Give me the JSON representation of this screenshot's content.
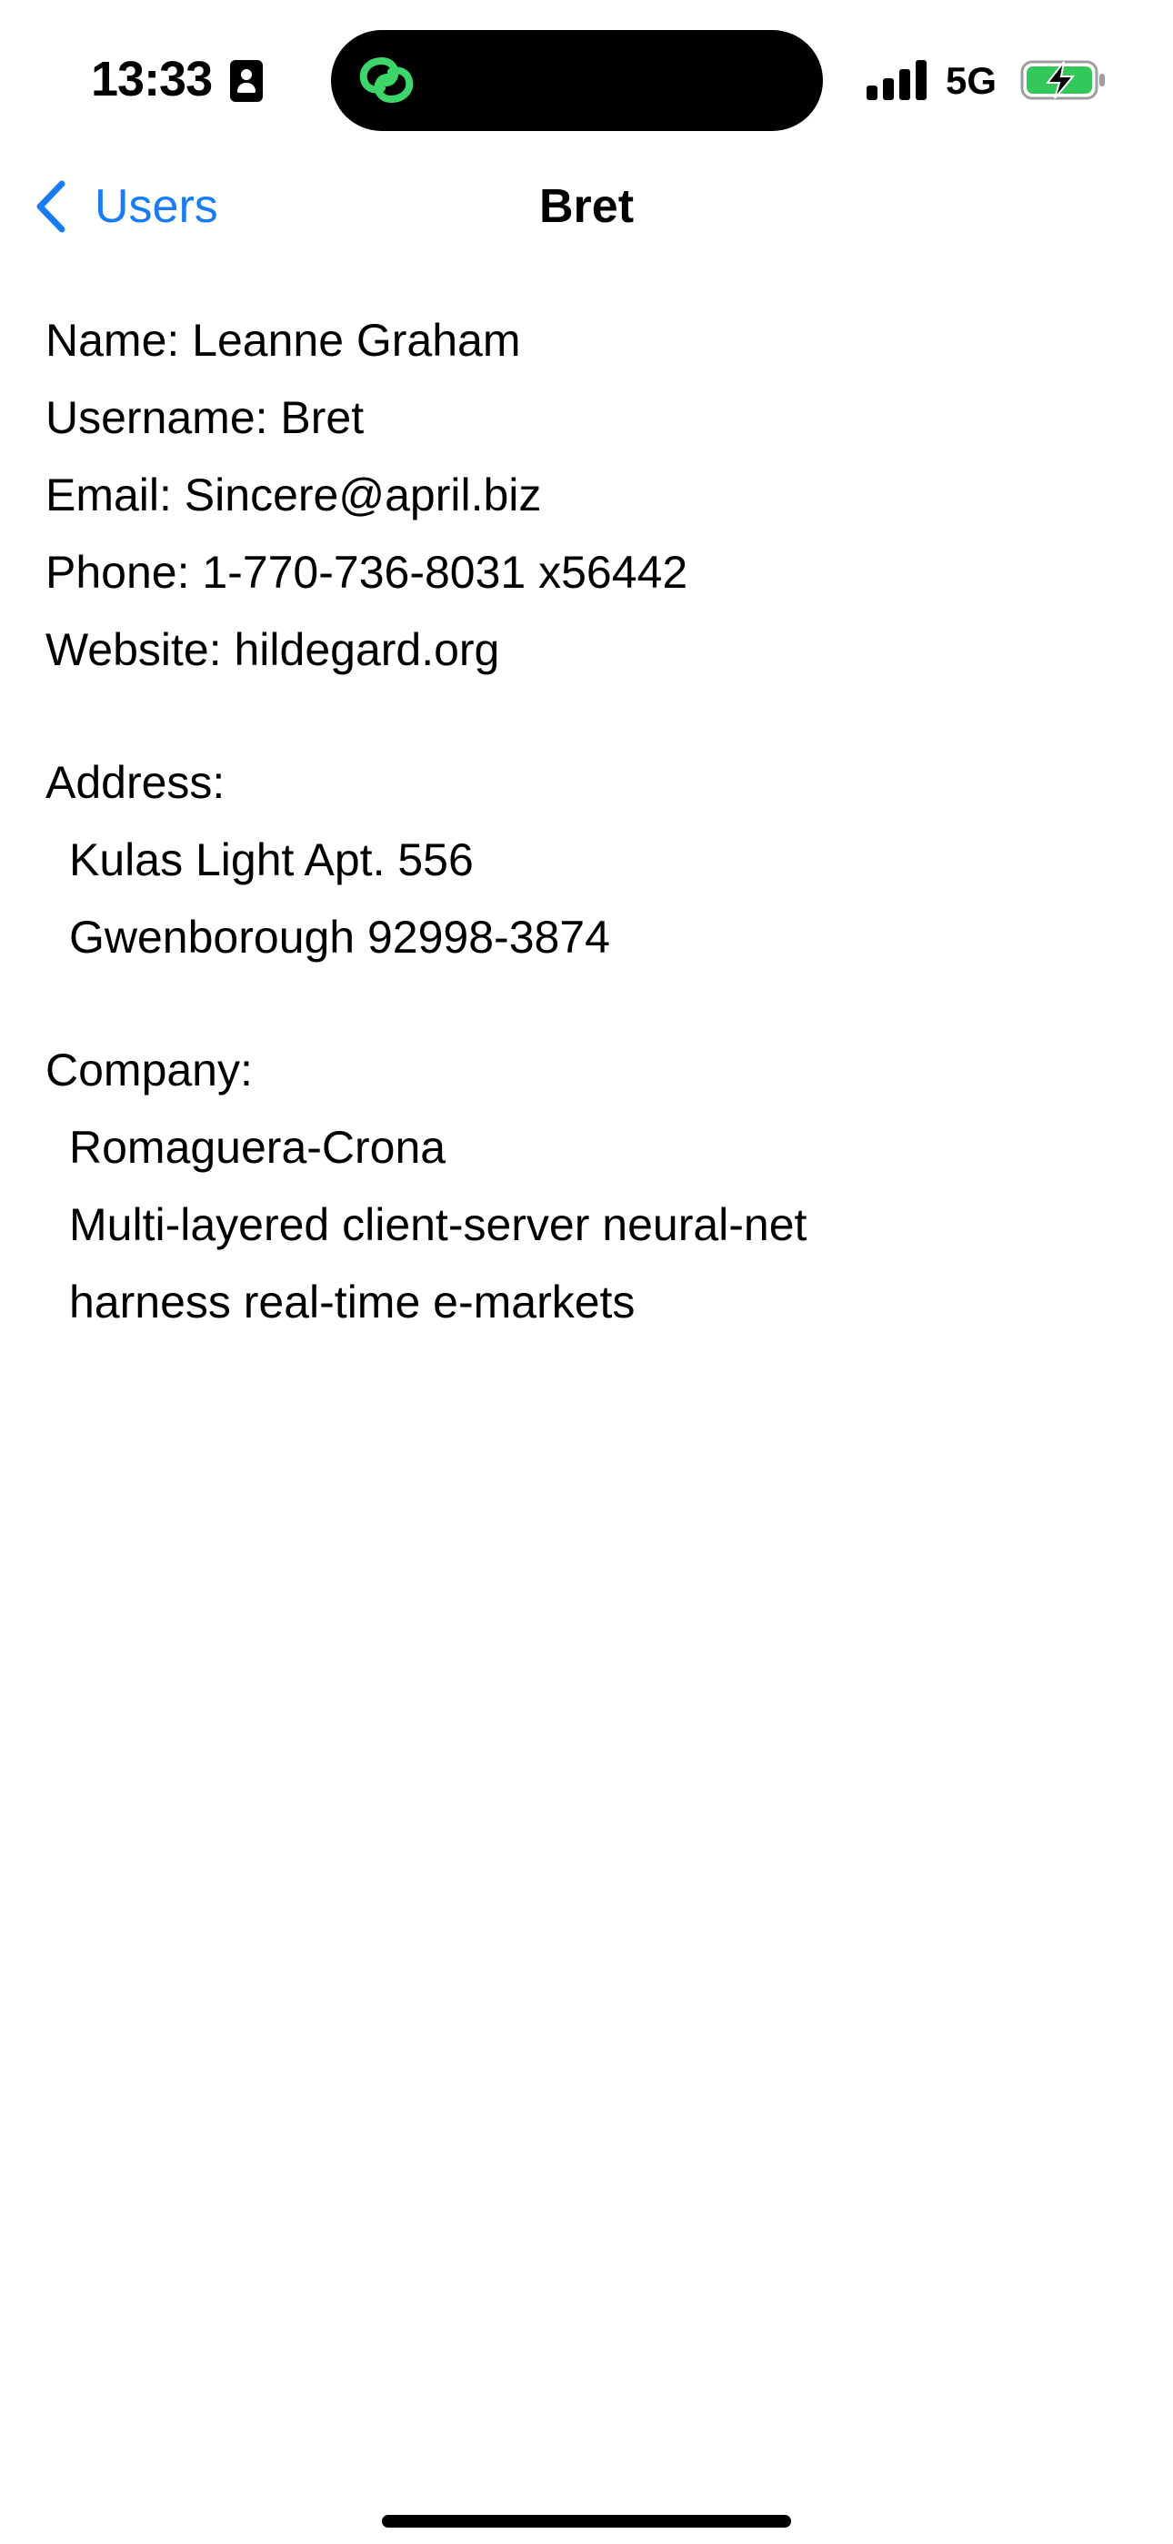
{
  "status_bar": {
    "time": "13:33",
    "network": "5G",
    "icons": [
      "contact-card-icon",
      "link-icon",
      "signal-icon",
      "battery-charging-icon"
    ],
    "island_icon_color": "#3bd56a",
    "battery_color": "#34c759"
  },
  "nav": {
    "back_label": "Users",
    "title": "Bret",
    "accent_color": "#1a7cf5"
  },
  "user": {
    "name_line": "Name: Leanne Graham",
    "username_line": "Username: Bret",
    "email_line": "Email: Sincere@april.biz",
    "phone_line": "Phone: 1-770-736-8031 x56442",
    "website_line": "Website: hildegard.org"
  },
  "address": {
    "heading": "Address:",
    "street_line": "Kulas Light Apt. 556",
    "city_line": "Gwenborough 92998-3874"
  },
  "company": {
    "heading": "Company:",
    "name": "Romaguera-Crona",
    "catch_phrase": "Multi-layered client-server neural-net",
    "bs": "harness real-time e-markets"
  }
}
